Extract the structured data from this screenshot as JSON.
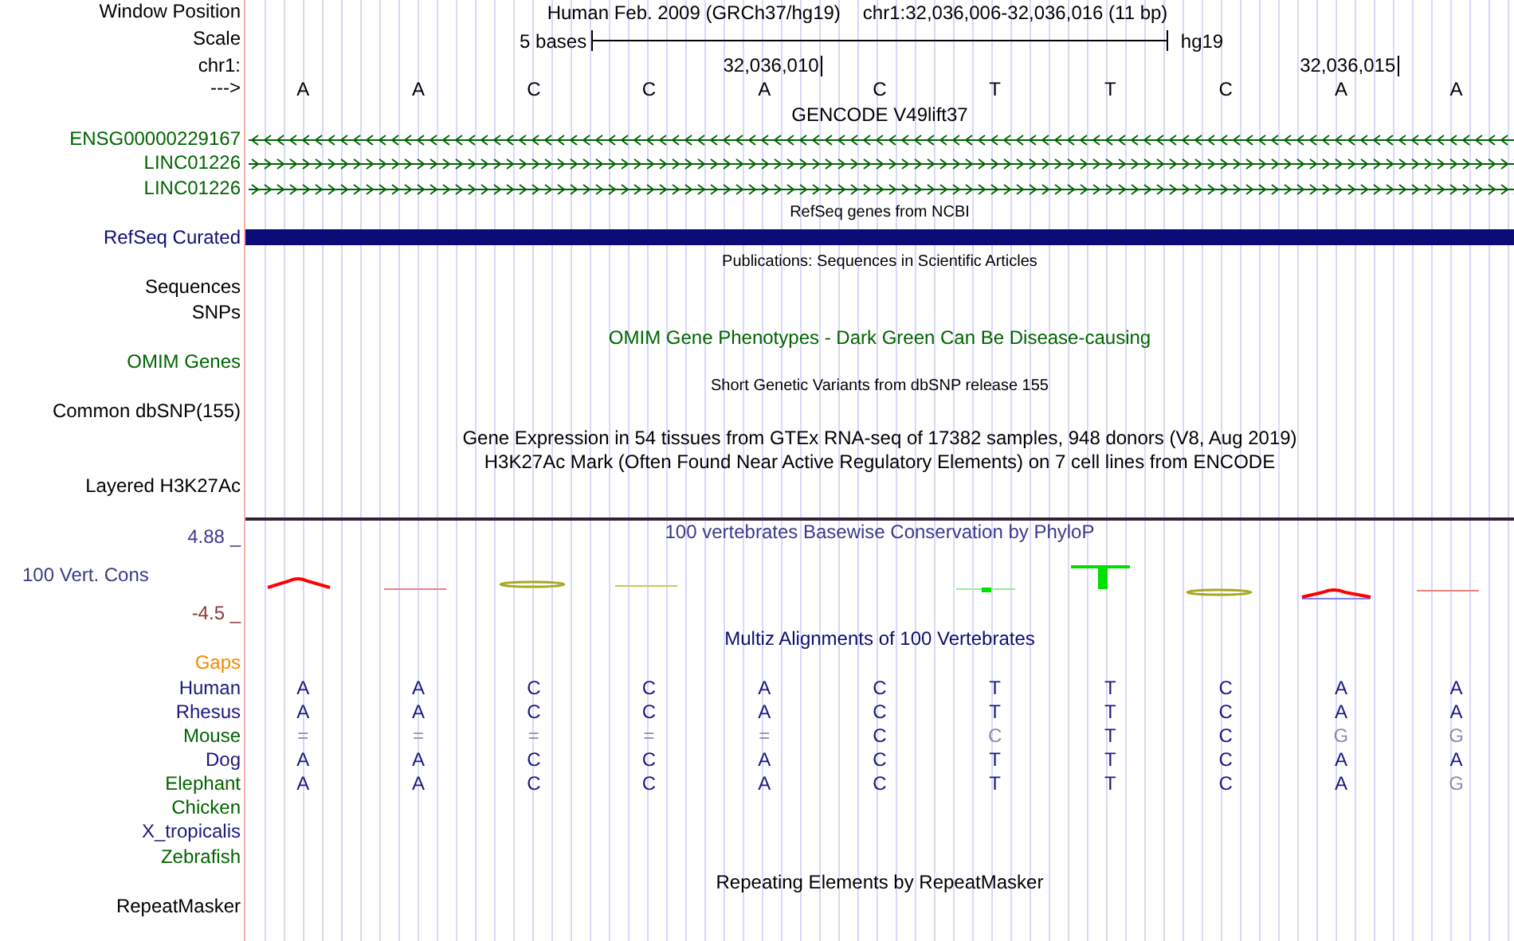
{
  "tracks": [
    {
      "kind": "header",
      "label": "Window Position",
      "assembly": "Human Feb. 2009 (GRCh37/hg19)",
      "position": "chr1:32,036,006-32,036,016 (11 bp)"
    },
    {
      "kind": "scale",
      "label": "Scale",
      "span": "5 bases",
      "assembly": "hg19"
    },
    {
      "kind": "ruler",
      "label": "chr1:",
      "ticks": [
        "32,036,010",
        "32,036,015"
      ]
    },
    {
      "kind": "bases",
      "label": "--->",
      "bases": [
        "A",
        "A",
        "C",
        "C",
        "A",
        "C",
        "T",
        "T",
        "C",
        "A",
        "A"
      ]
    },
    {
      "kind": "title",
      "text": "GENCODE V49lift37"
    },
    {
      "kind": "gene",
      "label": "ENSG00000229167",
      "color": "#006400",
      "reverse": true
    },
    {
      "kind": "gene",
      "label": "LINC01226",
      "color": "#006400",
      "reverse": false
    },
    {
      "kind": "gene",
      "label": "LINC01226",
      "color": "#006400",
      "reverse": false
    },
    {
      "kind": "subtitle",
      "text": "RefSeq genes from NCBI"
    },
    {
      "kind": "bar",
      "label": "RefSeq Curated",
      "color": "#0c0c78"
    },
    {
      "kind": "subtitle",
      "text": "Publications: Sequences in Scientific Articles"
    },
    {
      "kind": "label",
      "label": "Sequences"
    },
    {
      "kind": "label",
      "label": "SNPs"
    },
    {
      "kind": "title",
      "text": "OMIM Gene Phenotypes - Dark Green Can Be Disease-causing",
      "color": "#006400"
    },
    {
      "kind": "label",
      "label": "OMIM Genes",
      "color": "#006400"
    },
    {
      "kind": "subtitle",
      "text": "Short Genetic Variants from dbSNP release 155"
    },
    {
      "kind": "label",
      "label": "Common dbSNP(155)"
    },
    {
      "kind": "title",
      "text": "Gene Expression in 54 tissues from GTEx RNA-seq of 17382 samples, 948 donors (V8, Aug 2019)"
    },
    {
      "kind": "title",
      "text": "H3K27Ac Mark (Often Found Near Active Regulatory Elements) on 7 cell lines from ENCODE"
    },
    {
      "kind": "label",
      "label": "Layered H3K27Ac"
    },
    {
      "kind": "conservation",
      "label": "100 Vert. Cons",
      "title": "100 vertebrates Basewise Conservation by PhyloP",
      "max": "4.88 _",
      "min": "-4.5 _"
    },
    {
      "kind": "title",
      "text": "Multiz Alignments of 100 Vertebrates",
      "color": "#0c0c70"
    },
    {
      "kind": "label",
      "label": "Gaps",
      "color": "#f08c00"
    },
    {
      "kind": "alignment",
      "label": "Human",
      "color": "#1a1a80",
      "bases": [
        {
          "base": "A",
          "dimmed": false
        },
        {
          "base": "A",
          "dimmed": false
        },
        {
          "base": "C",
          "dimmed": false
        },
        {
          "base": "C",
          "dimmed": false
        },
        {
          "base": "A",
          "dimmed": false
        },
        {
          "base": "C",
          "dimmed": false
        },
        {
          "base": "T",
          "dimmed": false
        },
        {
          "base": "T",
          "dimmed": false
        },
        {
          "base": "C",
          "dimmed": false
        },
        {
          "base": "A",
          "dimmed": false
        },
        {
          "base": "A",
          "dimmed": false
        }
      ]
    },
    {
      "kind": "alignment",
      "label": "Rhesus",
      "color": "#1a1a80",
      "bases": [
        {
          "base": "A",
          "dimmed": false
        },
        {
          "base": "A",
          "dimmed": false
        },
        {
          "base": "C",
          "dimmed": false
        },
        {
          "base": "C",
          "dimmed": false
        },
        {
          "base": "A",
          "dimmed": false
        },
        {
          "base": "C",
          "dimmed": false
        },
        {
          "base": "T",
          "dimmed": false
        },
        {
          "base": "T",
          "dimmed": false
        },
        {
          "base": "C",
          "dimmed": false
        },
        {
          "base": "A",
          "dimmed": false
        },
        {
          "base": "A",
          "dimmed": false
        }
      ]
    },
    {
      "kind": "alignment",
      "label": "Mouse",
      "color": "#006400",
      "bases": [
        {
          "base": "=",
          "dimmed": true
        },
        {
          "base": "=",
          "dimmed": true
        },
        {
          "base": "=",
          "dimmed": true
        },
        {
          "base": "=",
          "dimmed": true
        },
        {
          "base": "=",
          "dimmed": true
        },
        {
          "base": "C",
          "dimmed": false
        },
        {
          "base": "C",
          "dimmed": true
        },
        {
          "base": "T",
          "dimmed": false
        },
        {
          "base": "C",
          "dimmed": false
        },
        {
          "base": "G",
          "dimmed": true
        },
        {
          "base": "G",
          "dimmed": true
        }
      ]
    },
    {
      "kind": "alignment",
      "label": "Dog",
      "color": "#1a1a80",
      "bases": [
        {
          "base": "A",
          "dimmed": false
        },
        {
          "base": "A",
          "dimmed": false
        },
        {
          "base": "C",
          "dimmed": false
        },
        {
          "base": "C",
          "dimmed": false
        },
        {
          "base": "A",
          "dimmed": false
        },
        {
          "base": "C",
          "dimmed": false
        },
        {
          "base": "T",
          "dimmed": false
        },
        {
          "base": "T",
          "dimmed": false
        },
        {
          "base": "C",
          "dimmed": false
        },
        {
          "base": "A",
          "dimmed": false
        },
        {
          "base": "A",
          "dimmed": false
        }
      ]
    },
    {
      "kind": "alignment",
      "label": "Elephant",
      "color": "#006400",
      "bases": [
        {
          "base": "A",
          "dimmed": false
        },
        {
          "base": "A",
          "dimmed": false
        },
        {
          "base": "C",
          "dimmed": false
        },
        {
          "base": "C",
          "dimmed": false
        },
        {
          "base": "A",
          "dimmed": false
        },
        {
          "base": "C",
          "dimmed": false
        },
        {
          "base": "T",
          "dimmed": false
        },
        {
          "base": "T",
          "dimmed": false
        },
        {
          "base": "C",
          "dimmed": false
        },
        {
          "base": "A",
          "dimmed": false
        },
        {
          "base": "G",
          "dimmed": true
        }
      ]
    },
    {
      "kind": "label",
      "label": "Chicken",
      "color": "#006400"
    },
    {
      "kind": "label",
      "label": "X_tropicalis",
      "color": "#1a1a80"
    },
    {
      "kind": "label",
      "label": "Zebrafish",
      "color": "#006400"
    },
    {
      "kind": "title",
      "text": "Repeating Elements by RepeatMasker"
    },
    {
      "kind": "label",
      "label": "RepeatMasker"
    }
  ]
}
